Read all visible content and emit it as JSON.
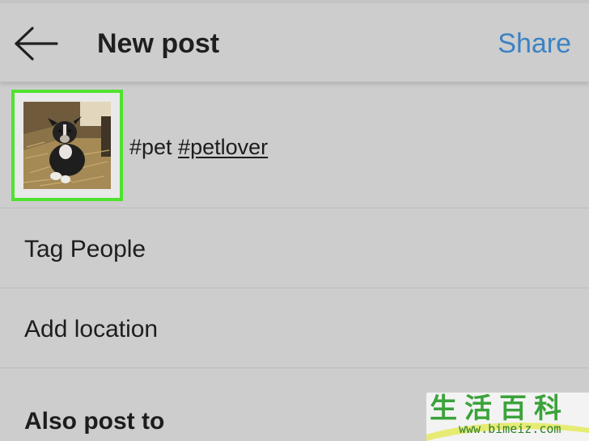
{
  "header": {
    "back_icon": "arrow-left-icon",
    "title": "New post",
    "share_label": "Share"
  },
  "post": {
    "thumbnail_icon": "puppy-photo-thumbnail",
    "caption_plain": "#pet ",
    "caption_link": "#petlover"
  },
  "menu": {
    "tag_people": "Tag People",
    "add_location": "Add location"
  },
  "section": {
    "also_post_to": "Also post to"
  },
  "watermark": {
    "chars": "生活百科",
    "url": "www.bimeiz.com"
  },
  "colors": {
    "background": "#cdcdcd",
    "accent_blue": "#3b82c4",
    "highlight_green": "#4fe22f",
    "text": "#1d1d1d"
  }
}
